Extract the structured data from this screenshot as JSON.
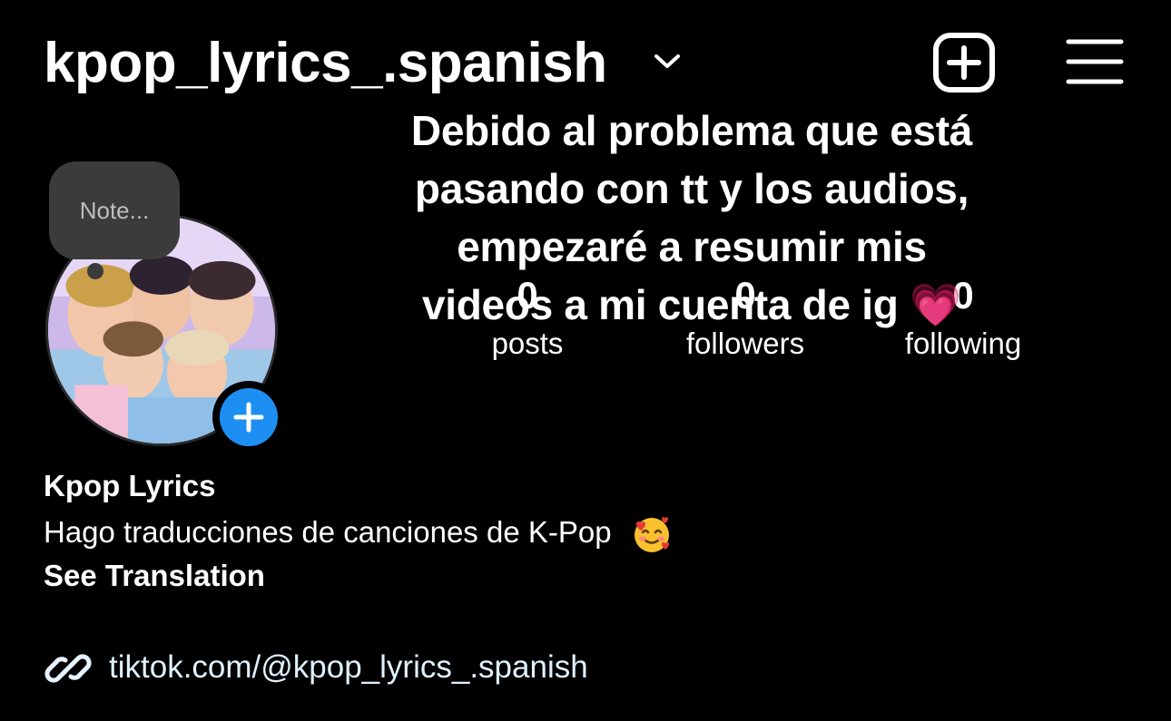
{
  "header": {
    "username": "kpop_lyrics_.spanish",
    "chevron_icon": "chevron-down-icon",
    "new_post_icon": "plus-square-icon",
    "menu_icon": "hamburger-menu-icon"
  },
  "overlay_message": {
    "lines": [
      "Debido al problema que está",
      "pasando con tt y los audios,",
      "empezaré a resumir mis",
      "videos a mi cuenta de ig 💗"
    ]
  },
  "note": {
    "placeholder": "Note..."
  },
  "avatar": {
    "icon": "profile-photo",
    "add_story_icon": "plus-icon"
  },
  "stats": [
    {
      "value": "0",
      "label": "posts"
    },
    {
      "value": "0",
      "label": "followers"
    },
    {
      "value": "0",
      "label": "following"
    }
  ],
  "profile": {
    "name": "Kpop Lyrics",
    "bio": "Hago traducciones de canciones de K-Pop",
    "bio_emoji": "smiling-face-with-hearts",
    "see_translation": "See Translation",
    "link": "tiktok.com/@kpop_lyrics_.spanish",
    "link_icon": "link-icon"
  },
  "colors": {
    "background": "#000000",
    "text": "#ffffff",
    "accent_blue": "#1d8ff2",
    "note_bubble": "#3b3b3b",
    "link_text": "#e0f1ff"
  }
}
